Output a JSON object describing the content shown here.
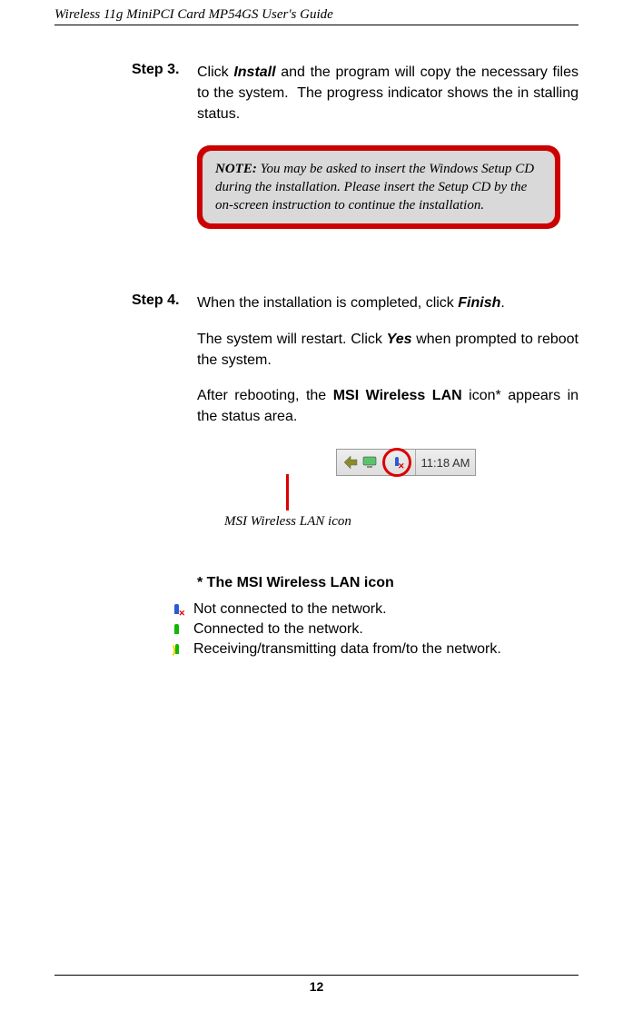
{
  "header": {
    "running_title": "Wireless 11g MiniPCI Card MP54GS User's Guide"
  },
  "step3": {
    "label": "Step 3.",
    "seg1": "Click ",
    "install": "Install",
    "seg2": " and the program will copy the necessary files to the system.  The progress indicator shows the in stalling status."
  },
  "note": {
    "title": "NOTE:",
    "body": " You may be asked to insert the Windows Setup CD during the installation.  Please insert the Setup CD by the on-screen instruction to continue the installation."
  },
  "step4": {
    "label": "Step 4.",
    "seg1": "When the installation is completed, click ",
    "finish": "Finish",
    "seg2": "."
  },
  "para_restart": {
    "seg1": "The system will restart.  Click ",
    "yes": "Yes",
    "seg2": " when prompted to reboot the system."
  },
  "para_reboot": {
    "seg1": "After rebooting, the ",
    "bold": "MSI Wireless LAN",
    "seg2": " icon* appears in the status area."
  },
  "tray": {
    "clock": "11:18 AM",
    "caption": "MSI Wireless LAN icon"
  },
  "icon_section": {
    "title": "* The MSI Wireless LAN icon",
    "items": [
      {
        "text": "Not connected to the network."
      },
      {
        "text": "Connected to the network."
      },
      {
        "text": "Receiving/transmitting data from/to the network."
      }
    ]
  },
  "footer": {
    "page": "12"
  }
}
